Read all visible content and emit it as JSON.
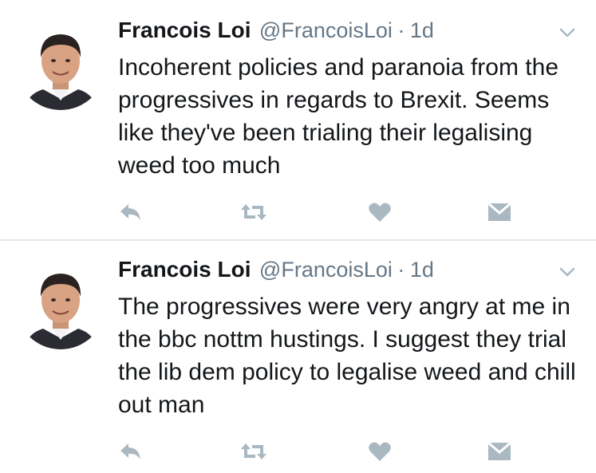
{
  "colors": {
    "text": "#14171a",
    "secondary": "#657786",
    "icon": "#aab8c2",
    "divider": "#e1e8ed"
  },
  "tweets": [
    {
      "author_name": "Francois Loi",
      "handle": "@FrancoisLoi",
      "separator": "·",
      "time": "1d",
      "text": "Incoherent policies and paranoia from the progressives in regards to Brexit. Seems like they've been trialing their legalising weed too much",
      "icons": [
        "reply-icon",
        "retweet-icon",
        "like-icon",
        "direct-message-icon",
        "chevron-down-icon"
      ]
    },
    {
      "author_name": "Francois Loi",
      "handle": "@FrancoisLoi",
      "separator": "·",
      "time": "1d",
      "text": "The progressives were very angry at me in the bbc nottm hustings. I suggest they trial the lib dem policy to legalise weed and chill out man",
      "icons": [
        "reply-icon",
        "retweet-icon",
        "like-icon",
        "direct-message-icon",
        "chevron-down-icon"
      ]
    }
  ]
}
